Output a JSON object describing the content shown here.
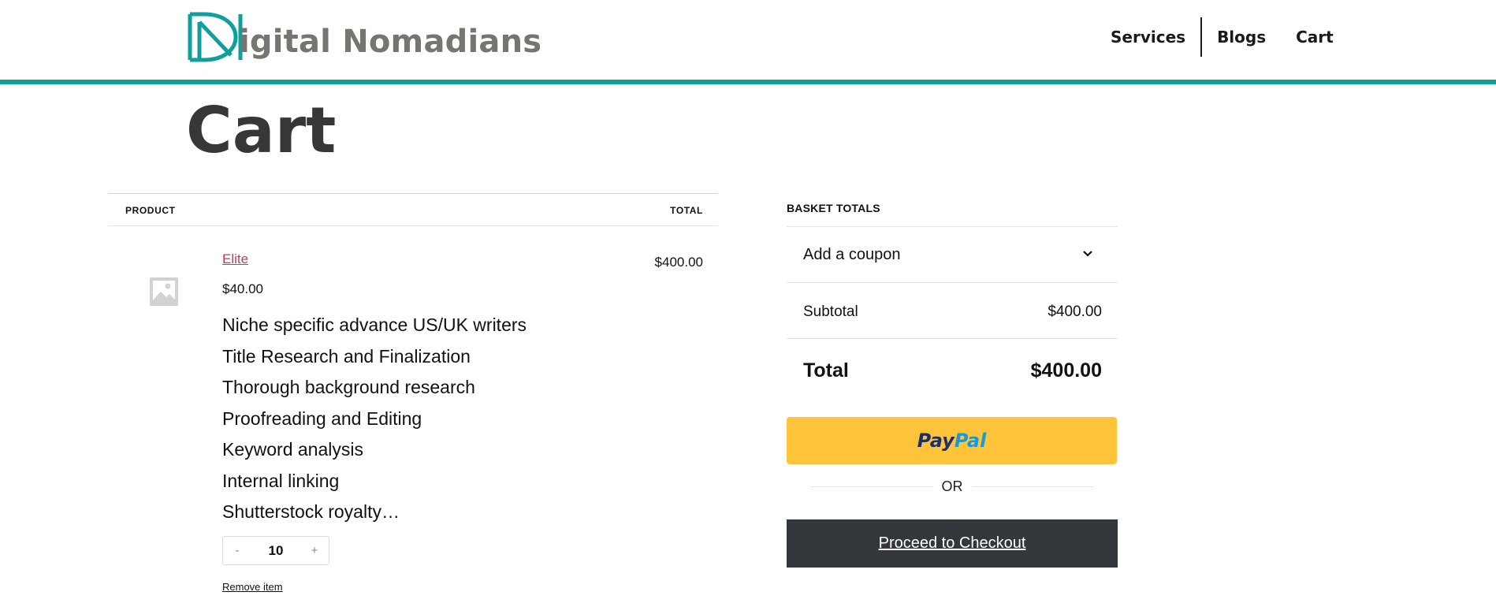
{
  "header": {
    "logo_text": "igital Nomadians",
    "logo_letter": "D",
    "nav": [
      {
        "label": "Services"
      },
      {
        "label": "Blogs"
      },
      {
        "label": "Cart"
      }
    ]
  },
  "page": {
    "title": "Cart"
  },
  "cart_table": {
    "col_product": "PRODUCT",
    "col_total": "TOTAL",
    "item": {
      "name": "Elite",
      "price": "$40.00",
      "line_total": "$400.00",
      "features": [
        "Niche specific advance US/UK writers",
        "Title Research and Finalization",
        "Thorough background research",
        "Proofreading and Editing",
        "Keyword analysis",
        "Internal linking",
        "Shutterstock royalty…"
      ],
      "quantity": "10",
      "qty_minus": "-",
      "qty_plus": "+",
      "remove_label": "Remove item"
    }
  },
  "totals": {
    "heading": "BASKET TOTALS",
    "coupon_label": "Add a coupon",
    "subtotal_label": "Subtotal",
    "subtotal_value": "$400.00",
    "total_label": "Total",
    "total_value": "$400.00",
    "paypal_part1": "Pay",
    "paypal_part2": "Pal",
    "or_label": "OR",
    "checkout_label": "Proceed to Checkout"
  },
  "colors": {
    "brand_teal": "#0f9f9c",
    "logo_gray": "#76756f",
    "paypal_yellow": "#ffc439",
    "checkout_dark": "#33373b",
    "link_pink": "#c0395c"
  }
}
